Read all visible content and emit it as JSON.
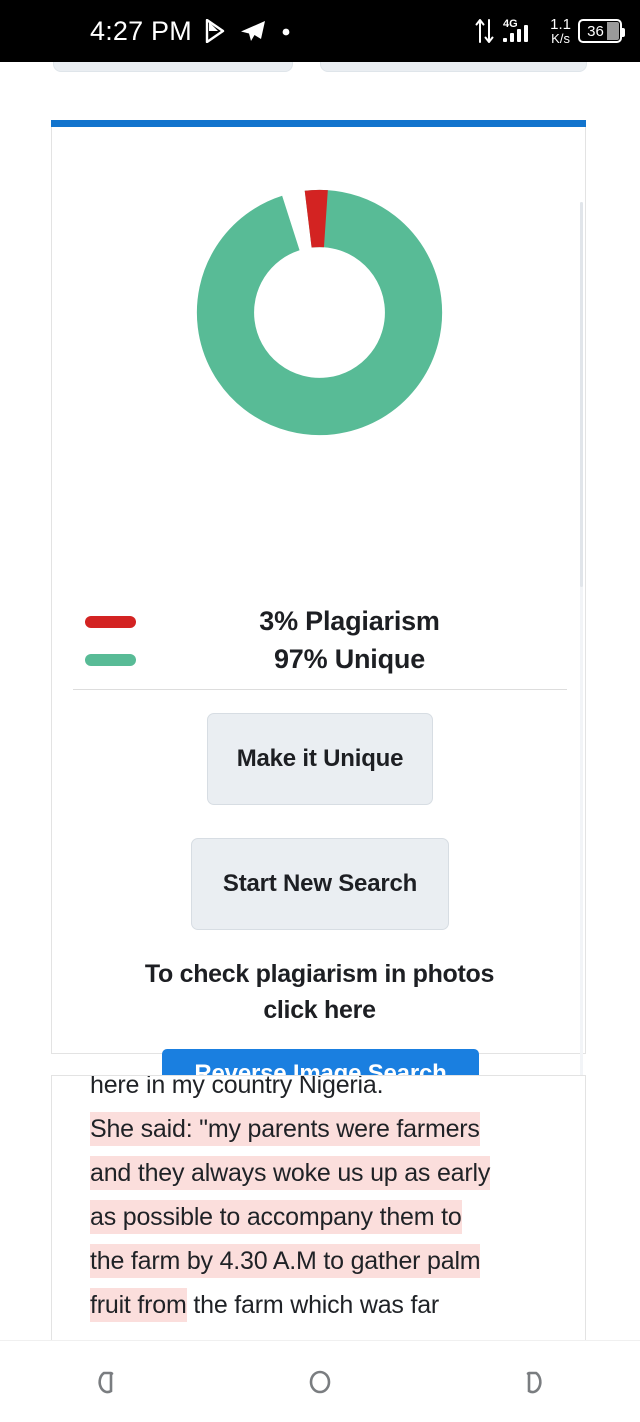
{
  "status_bar": {
    "time": "4:27 PM",
    "network_speed_value": "1.1",
    "network_speed_unit": "K/s",
    "network_type": "4G",
    "battery_level": "36",
    "icons": [
      "play-store-icon",
      "telegram-icon",
      "dot-icon",
      "data-transfer-icon",
      "signal-bars-icon",
      "battery-icon"
    ]
  },
  "result_card": {
    "accent_color": "#1274cd",
    "legend": [
      {
        "label": "3% Plagiarism",
        "color": "#d32322"
      },
      {
        "label": "97% Unique",
        "color": "#58bb96"
      }
    ],
    "buttons": {
      "make_unique": "Make it Unique",
      "start_new_search": "Start New Search",
      "reverse_image_search": "Reverse Image Search"
    },
    "photo_prompt_line1": "To check plagiarism in photos",
    "photo_prompt_line2": "click here"
  },
  "chart_data": {
    "type": "pie",
    "variant": "donut",
    "title": "",
    "categories": [
      "Plagiarism",
      "Unique"
    ],
    "values": [
      3,
      97
    ],
    "labels": [
      "3% Plagiarism",
      "97% Unique"
    ],
    "colors": [
      "#d32322",
      "#58bb96"
    ],
    "units": "percent",
    "start_angle_deg": -7,
    "inner_radius_ratio": 0.565,
    "legend_position": "below",
    "grid": false
  },
  "text_card": {
    "lines": [
      {
        "text": "here in my country Nigeria.",
        "highlighted": false,
        "clipped_top": true
      },
      {
        "text": "She said: \"my parents were farmers",
        "highlighted": true
      },
      {
        "text": "and they always woke us up as early",
        "highlighted": true
      },
      {
        "text": "as possible to accompany them to",
        "highlighted": true
      },
      {
        "text": "the farm by 4.30 A.M to gather palm",
        "highlighted": true
      },
      {
        "text_highlighted": "fruit from",
        "text_plain": " the farm which was far",
        "highlighted": "partial"
      }
    ],
    "highlight_color": "#fbdedc"
  },
  "nav_bar": {
    "back_label": "back-icon",
    "home_label": "home-icon",
    "recents_label": "recents-icon"
  }
}
